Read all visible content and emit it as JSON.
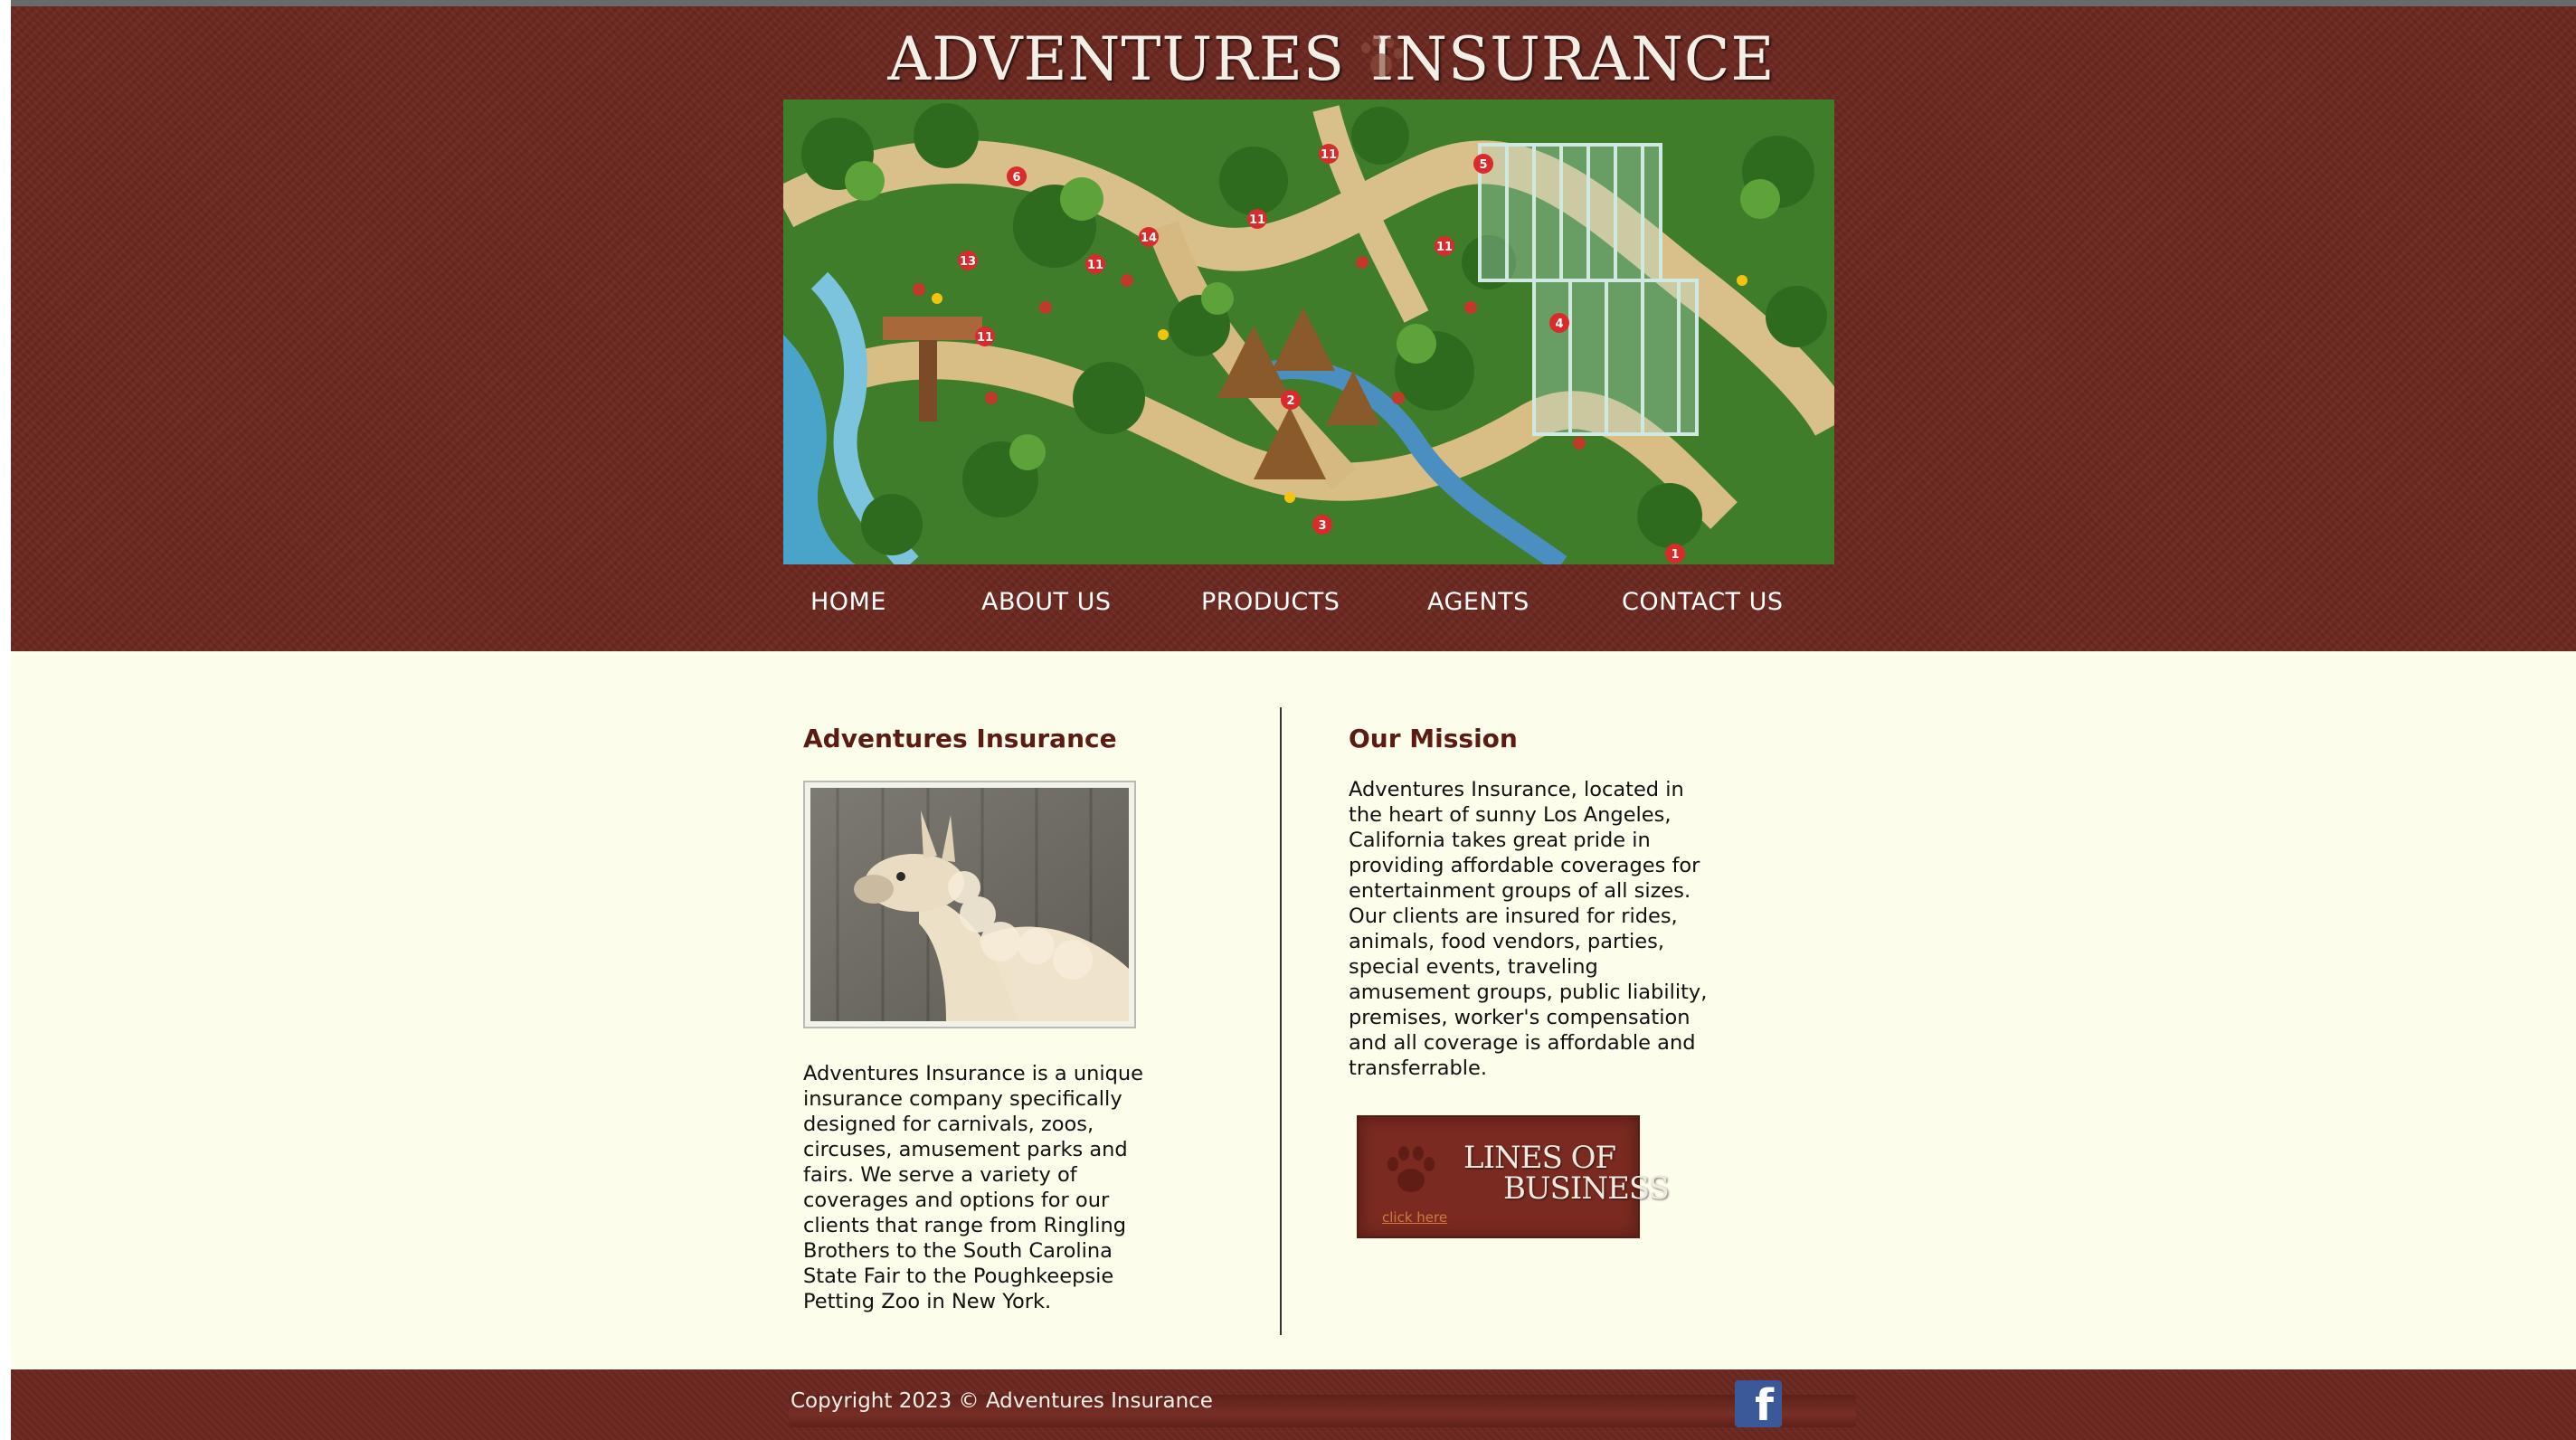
{
  "site": {
    "logo_left": "ADVENTURES",
    "logo_right": "INSURANCE"
  },
  "nav": {
    "items": [
      {
        "label": "HOME"
      },
      {
        "label": "ABOUT US"
      },
      {
        "label": "PRODUCTS"
      },
      {
        "label": "AGENTS"
      },
      {
        "label": "CONTACT US"
      }
    ]
  },
  "left_column": {
    "heading": "Adventures Insurance",
    "paragraph": "Adventures Insurance is a unique insurance company specifically designed for carnivals, zoos, circuses, amusement parks and fairs. We serve a variety of coverages and options for our clients that range from Ringling Brothers to the South Carolina State Fair to the Poughkeepsie Petting Zoo in New York."
  },
  "right_column": {
    "heading": "Our Mission",
    "paragraph": "Adventures Insurance, located in the heart of sunny Los Angeles, California takes great pride in providing affordable coverages for entertainment groups of all sizes. Our clients are insured for rides, animals, food vendors, parties, special events, traveling amusement groups, public liability, premises, worker's compensation and all coverage is affordable and transferrable."
  },
  "lines_of_business": {
    "title_line1": "LINES OF",
    "title_line2": "BUSINESS",
    "click_label": "click here"
  },
  "footer": {
    "copyright": "Copyright 2023 © Adventures Insurance"
  },
  "hero": {
    "markers": [
      "1",
      "2",
      "3",
      "4",
      "5",
      "6",
      "11",
      "11",
      "11",
      "11",
      "11",
      "13",
      "14"
    ]
  },
  "colors": {
    "header_bg": "#6b2820",
    "page_bg": "#fdfdec",
    "heading": "#5b1a12",
    "facebook": "#3b5998"
  },
  "icons": {
    "paw": "paw-icon",
    "facebook": "facebook-icon"
  }
}
